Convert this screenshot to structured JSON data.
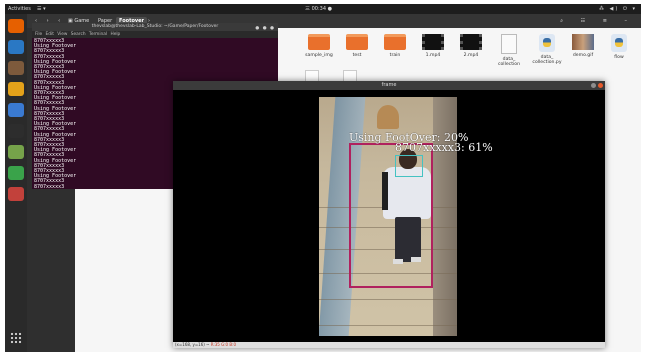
{
  "topbar": {
    "activities": "Activities",
    "app_menu": "☰ ▾",
    "clock": "三 00:34 ●",
    "tray": "⁂ ◀) ⏻ ▾"
  },
  "file_manager": {
    "nav": "‹ › ‹",
    "crumbs": [
      "▣ Game",
      "Paper",
      "Footover",
      "›"
    ],
    "tools": "⌕ ☷ ≡ –",
    "items": [
      {
        "name": "sample_img",
        "kind": "folder"
      },
      {
        "name": "test",
        "kind": "folder"
      },
      {
        "name": "train",
        "kind": "folder"
      },
      {
        "name": "1.mp4",
        "kind": "video"
      },
      {
        "name": "2.mp4",
        "kind": "video"
      },
      {
        "name": "data_\ncollection",
        "kind": "doc"
      },
      {
        "name": "data_\ncollection.py",
        "kind": "python"
      },
      {
        "name": "demo.gif",
        "kind": "gif"
      },
      {
        "name": "flow",
        "kind": "python"
      }
    ]
  },
  "terminal": {
    "title": "thevslab@thevslab-Lab_Studio: ~/Game/Paper/Footover",
    "menu": "File Edit View Search Terminal Help",
    "lines": [
      "8707xxxxx3",
      "Using Footover",
      "8707xxxxx3",
      "8707xxxxx3",
      "Using Footover",
      "8707xxxxx3",
      "Using Footover",
      "8707xxxxx3",
      "8707xxxxx3",
      "Using Footover",
      "8707xxxxx3",
      "Using Footover",
      "8707xxxxx3",
      "Using Footover",
      "8707xxxxx3",
      "8707xxxxx3",
      "Using Footover",
      "8707xxxxx3",
      "Using Footover",
      "8707xxxxx3",
      "8707xxxxx3",
      "Using Footover",
      "8707xxxxx3",
      "Using Footover",
      "8707xxxxx3",
      "8707xxxxx3",
      "Using Footover",
      "8707xxxxx3",
      "8707xxxxx3"
    ]
  },
  "frame": {
    "title": "frame",
    "status_prefix": "(x=168, y=16) ~ ",
    "status_values": "R:35 G:0 B:0",
    "detection_label_1": "Using FootOver: 20%",
    "detection_label_2": "8707xxxxx3: 61%",
    "colors": {
      "body_box": "#b0215e",
      "face_box": "#44c2c2"
    }
  },
  "dock": {
    "icons": [
      "firefox-icon",
      "thunderbird-icon",
      "files-icon",
      "rhythmbox-icon",
      "writer-icon",
      "terminal-icon",
      "text-editor-icon",
      "calc-icon",
      "impress-icon"
    ],
    "colors": [
      "#e66000",
      "#2a78c4",
      "#7d5a3c",
      "#e4a21a",
      "#3a7ad1",
      "#2d2d2d",
      "#76a34a",
      "#3aa34a",
      "#c2413b"
    ]
  }
}
